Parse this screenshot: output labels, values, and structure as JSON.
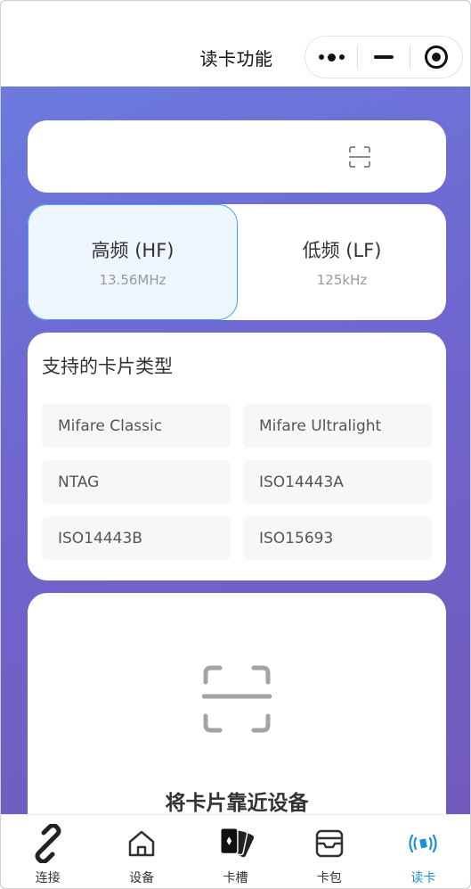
{
  "header": {
    "title": "读卡功能"
  },
  "frequency": {
    "options": [
      {
        "label": "高频 (HF)",
        "sub": "13.56MHz",
        "selected": true
      },
      {
        "label": "低频 (LF)",
        "sub": "125kHz",
        "selected": false
      }
    ]
  },
  "card_types": {
    "title": "支持的卡片类型",
    "items": [
      "Mifare Classic",
      "Mifare Ultralight",
      "NTAG",
      "ISO14443A",
      "ISO14443B",
      "ISO15693"
    ]
  },
  "read_panel": {
    "prompt": "将卡片靠近设备"
  },
  "tabbar": {
    "items": [
      {
        "label": "连接",
        "icon": "link-icon"
      },
      {
        "label": "设备",
        "icon": "home-icon"
      },
      {
        "label": "卡槽",
        "icon": "cards-icon"
      },
      {
        "label": "卡包",
        "icon": "wallet-icon"
      },
      {
        "label": "读卡",
        "icon": "nfc-icon",
        "active": true
      }
    ],
    "active_color": "#1e8fd6"
  }
}
